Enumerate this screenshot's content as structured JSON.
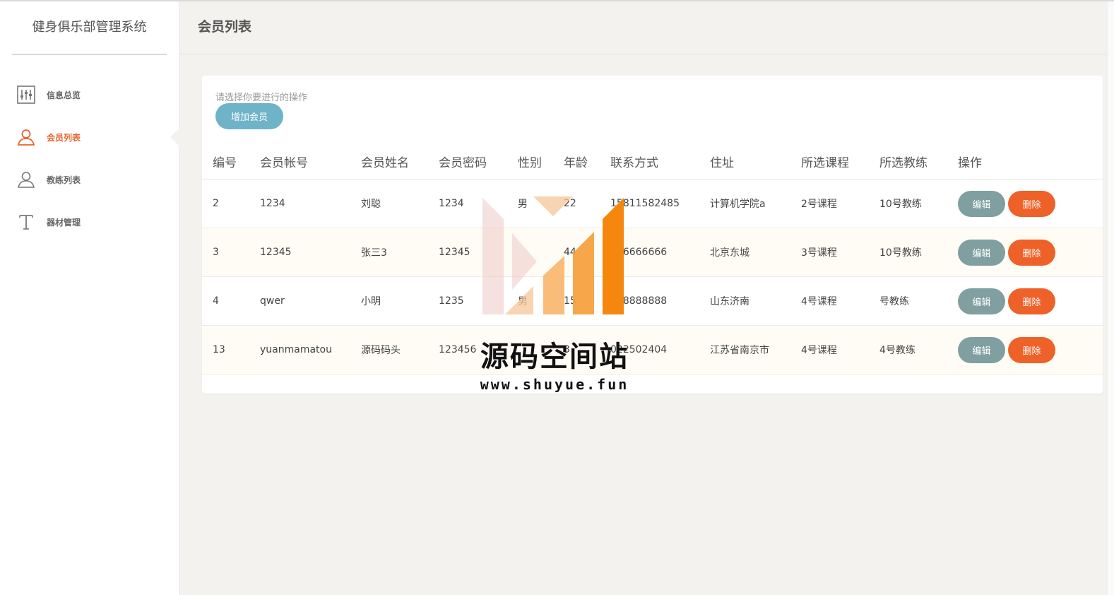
{
  "app": {
    "title": "健身俱乐部管理系统"
  },
  "sidebar": {
    "items": [
      {
        "label": "信息总览",
        "icon": "sliders-icon",
        "active": false
      },
      {
        "label": "会员列表",
        "icon": "user-icon",
        "active": true
      },
      {
        "label": "教练列表",
        "icon": "user-outline-icon",
        "active": false
      },
      {
        "label": "器材管理",
        "icon": "text-t-icon",
        "active": false
      }
    ]
  },
  "header": {
    "title": "会员列表"
  },
  "main": {
    "hint": "请选择你要进行的操作",
    "add_button": "增加会员",
    "columns": [
      "编号",
      "会员帐号",
      "会员姓名",
      "会员密码",
      "性别",
      "年龄",
      "联系方式",
      "住址",
      "所选课程",
      "所选教练",
      "操作"
    ],
    "rows": [
      {
        "id": "2",
        "account": "1234",
        "name": "刘聪",
        "password": "1234",
        "gender": "男",
        "age": "22",
        "phone": "15811582485",
        "address": "计算机学院a",
        "course": "2号课程",
        "coach": "10号教练"
      },
      {
        "id": "3",
        "account": "12345",
        "name": "张三3",
        "password": "12345",
        "gender": "",
        "age": "44",
        "phone": "666666666",
        "address": "北京东城",
        "course": "3号课程",
        "coach": "10号教练"
      },
      {
        "id": "4",
        "account": "qwer",
        "name": "小明",
        "password": "1235",
        "gender": "男",
        "age": "15",
        "phone": "888888888",
        "address": "山东济南",
        "course": "4号课程",
        "coach": "号教练"
      },
      {
        "id": "13",
        "account": "yuanmamatou",
        "name": "源码码头",
        "password": "123456",
        "gender": "",
        "age": "3",
        "phone": "022502404",
        "address": "江苏省南京市",
        "course": "4号课程",
        "coach": "4号教练"
      }
    ],
    "edit_label": "编辑",
    "delete_label": "删除"
  },
  "watermark": {
    "title": "源码空间站",
    "url": "www.shuyue.fun"
  },
  "colors": {
    "accent": "#e8642e",
    "add_button": "#6fb3c9",
    "edit_button": "#7f9fa0",
    "delete_button": "#ee6128"
  }
}
